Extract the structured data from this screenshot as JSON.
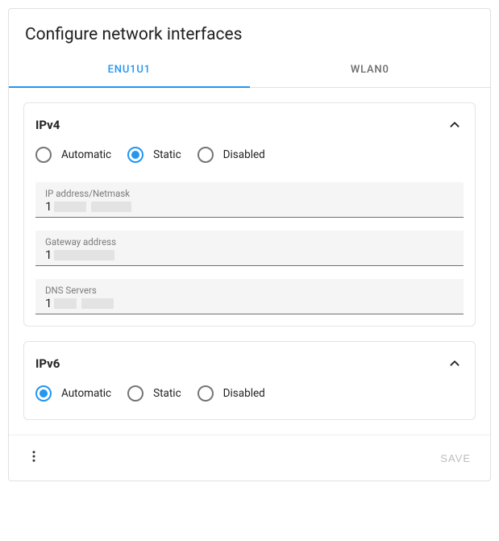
{
  "title": "Configure network interfaces",
  "tabs": [
    {
      "label": "ENU1U1",
      "active": true
    },
    {
      "label": "WLAN0",
      "active": false
    }
  ],
  "ipv4": {
    "title": "IPv4",
    "expanded": true,
    "options": {
      "automatic": "Automatic",
      "static": "Static",
      "disabled": "Disabled"
    },
    "selected": "static",
    "fields": {
      "ip": {
        "label": "IP address/Netmask",
        "value": "1"
      },
      "gw": {
        "label": "Gateway address",
        "value": "1"
      },
      "dns": {
        "label": "DNS Servers",
        "value": "1"
      }
    }
  },
  "ipv6": {
    "title": "IPv6",
    "expanded": true,
    "options": {
      "automatic": "Automatic",
      "static": "Static",
      "disabled": "Disabled"
    },
    "selected": "automatic"
  },
  "footer": {
    "save": "SAVE"
  }
}
